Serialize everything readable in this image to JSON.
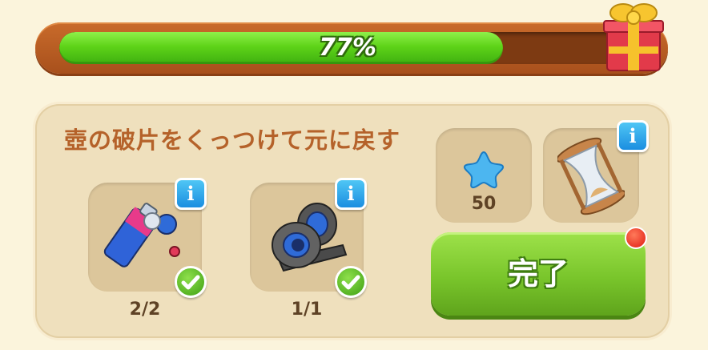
{
  "progress": {
    "value": 0.77,
    "label": "77%"
  },
  "task": {
    "title": "壺の破片をくっつけて元に戻す",
    "items": [
      {
        "icon": "glue-tube-icon",
        "count": "2/2",
        "completed": true
      },
      {
        "icon": "duct-tape-icon",
        "count": "1/1",
        "completed": true
      }
    ]
  },
  "rewards": [
    {
      "icon": "blue-star-icon",
      "amount": "50"
    },
    {
      "icon": "hourglass-icon"
    }
  ],
  "actions": {
    "complete_label": "完了"
  },
  "info_glyph": "i",
  "colors": {
    "title": "#b5622a",
    "progress_fill": "#5ed318",
    "complete_button": "#79c52b",
    "info_button": "#1b8ee0"
  }
}
